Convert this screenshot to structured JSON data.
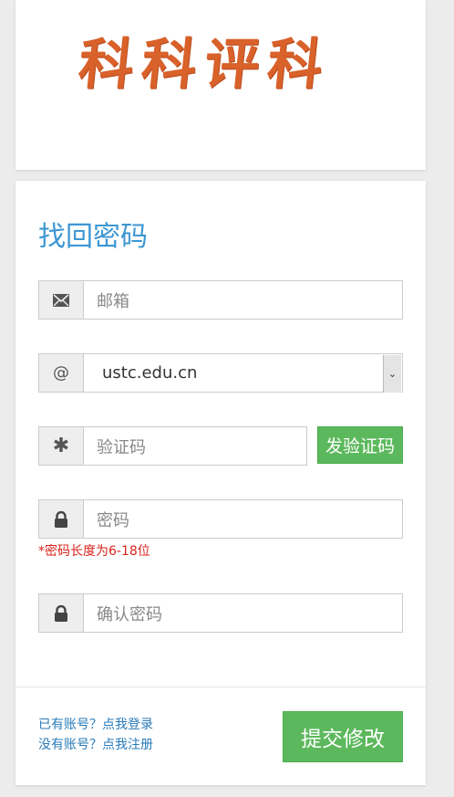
{
  "logo": {
    "text": "科科评科",
    "color": "#d9612a"
  },
  "form": {
    "title": "找回密码",
    "email": {
      "placeholder": "邮箱",
      "icon": "envelope-icon"
    },
    "domain": {
      "value": "ustc.edu.cn",
      "icon_text": "@"
    },
    "code": {
      "placeholder": "验证码",
      "icon": "asterisk-icon",
      "send_label": "发验证码"
    },
    "password": {
      "placeholder": "密码",
      "icon": "lock-icon",
      "hint": "*密码长度为6-18位"
    },
    "confirm_password": {
      "placeholder": "确认密码",
      "icon": "lock-icon"
    },
    "links": {
      "login": "已有账号？点我登录",
      "register": "没有账号？点我注册"
    },
    "submit_label": "提交修改"
  },
  "colors": {
    "accent": "#3d97d3",
    "button": "#5cb85c",
    "error": "#d9231c",
    "link": "#2a7bb8"
  }
}
